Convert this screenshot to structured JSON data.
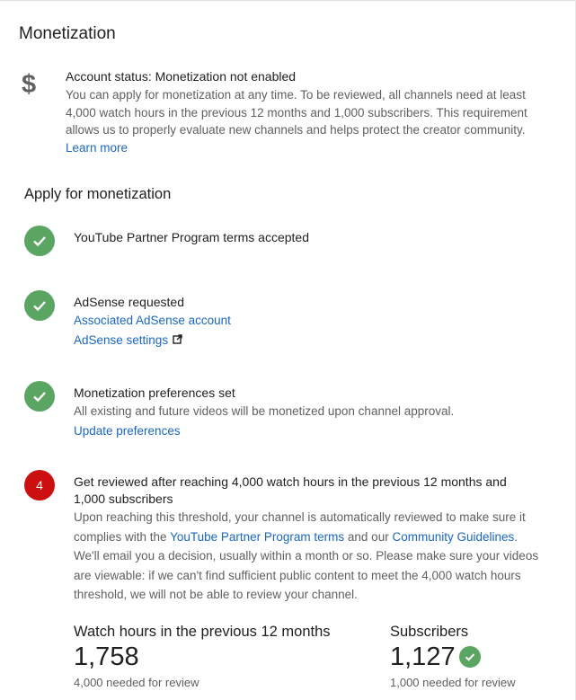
{
  "header": {
    "title": "Monetization"
  },
  "account": {
    "icon": "dollar-icon",
    "status": "Account status: Monetization not enabled",
    "description": "You can apply for monetization at any time. To be reviewed, all channels need at least 4,000 watch hours in the previous 12 months and 1,000 subscribers. This requirement allows us to properly evaluate new channels and helps protect the creator community.",
    "learn_more": "Learn more"
  },
  "apply": {
    "title": "Apply for monetization",
    "steps": [
      {
        "status": "complete",
        "icon": "check-icon",
        "title": "YouTube Partner Program terms accepted"
      },
      {
        "status": "complete",
        "icon": "check-icon",
        "title": "AdSense requested",
        "link1": "Associated AdSense account",
        "link2": "AdSense settings",
        "link2_icon": "external-link-icon"
      },
      {
        "status": "complete",
        "icon": "check-icon",
        "title": "Monetization preferences set",
        "description": "All existing and future videos will be monetized upon channel approval.",
        "link": "Update preferences"
      },
      {
        "status": "pending",
        "number": "4",
        "title": "Get reviewed after reaching 4,000 watch hours in the previous 12 months and 1,000 subscribers",
        "desc_part1": "Upon reaching this threshold, your channel is automatically reviewed to make sure it complies with the ",
        "link1": "YouTube Partner Program terms",
        "desc_part2": " and our ",
        "link2": "Community Guidelines",
        "desc_part3": ". We'll email you a decision, usually within a month or so. Please make sure your videos are viewable: if we can't find sufficient public content to meet the 4,000 watch hours threshold, we will not be able to review your channel."
      }
    ]
  },
  "metrics": {
    "watch_hours": {
      "label": "Watch hours in the previous 12 months",
      "value": "1,758",
      "sub": "4,000 needed for review"
    },
    "subscribers": {
      "label": "Subscribers",
      "value": "1,127",
      "sub": "1,000 needed for review",
      "icon": "check-icon"
    }
  },
  "colors": {
    "accent_link": "#1a67c0",
    "success": "#5aa562",
    "error": "#cc1010"
  }
}
